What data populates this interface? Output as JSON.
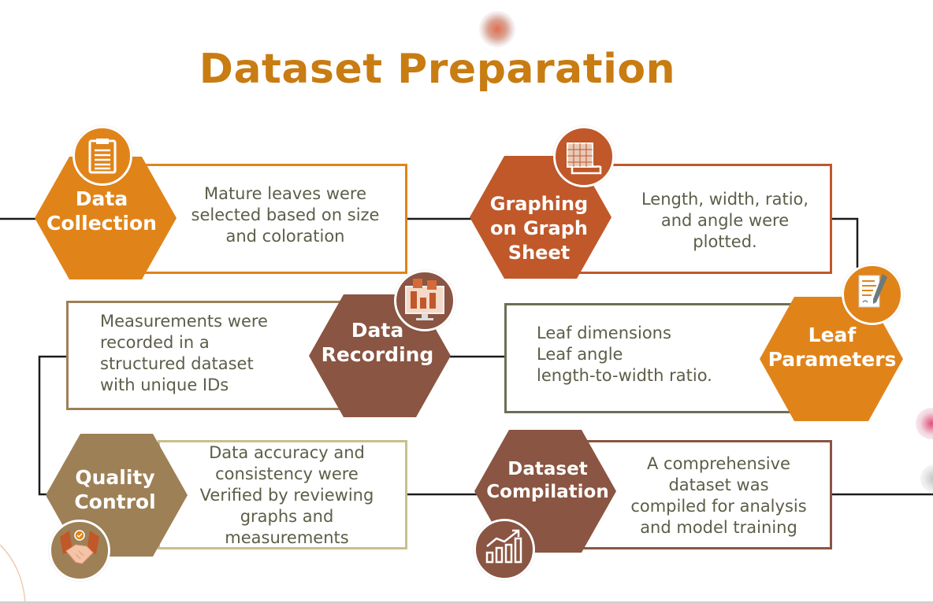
{
  "title": "Dataset Preparation",
  "colors": {
    "title": "#c87c12",
    "orange": "#e0841a",
    "rust": "#c0582a",
    "brown": "#8a5542",
    "tan": "#9e8057",
    "text": "#5d5d48"
  },
  "steps": {
    "data_collection": {
      "label": "Data\nCollection",
      "description": "Mature leaves were\nselected based on size\nand coloration",
      "icon": "clipboard-icon"
    },
    "graphing": {
      "label": "Graphing\non Graph\nSheet",
      "description": "Length, width, ratio,\nand angle were\nplotted.",
      "icon": "graph-sheet-icon"
    },
    "leaf_parameters": {
      "label": "Leaf\nParameters",
      "description": "Leaf dimensions\nLeaf angle\nlength-to-width ratio.",
      "icon": "document-pen-icon"
    },
    "data_recording": {
      "label": "Data\nRecording",
      "description": "Measurements were\nrecorded in a\nstructured dataset\nwith unique IDs",
      "icon": "monitor-icon"
    },
    "quality_control": {
      "label": "Quality\nControl",
      "description": "Data accuracy and\nconsistency were\nVerified by reviewing\ngraphs and\nmeasurements",
      "icon": "handshake-icon"
    },
    "dataset_compilation": {
      "label": "Dataset\nCompilation",
      "description": "A comprehensive\ndataset was\ncompiled for analysis\nand model training",
      "icon": "growth-chart-icon"
    }
  }
}
